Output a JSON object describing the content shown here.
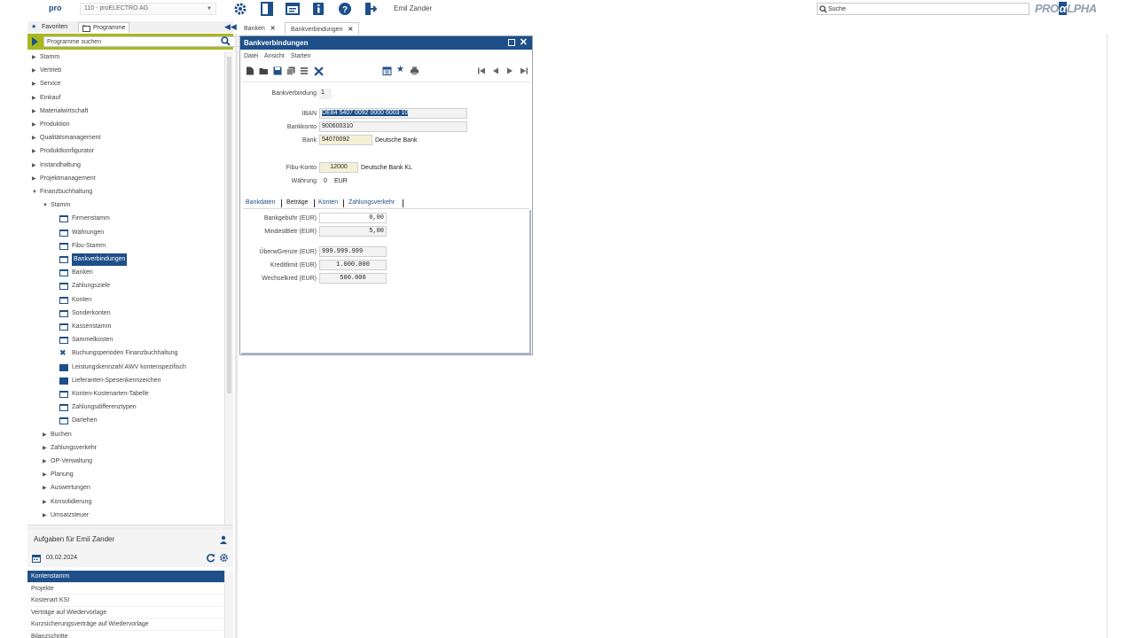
{
  "topbar": {
    "logo": "pro",
    "company": "110 - proELECTRO AG",
    "icons": [
      "gear-icon",
      "layout-icon",
      "panel-icon",
      "info-icon",
      "help-icon",
      "exit-icon"
    ],
    "user": "Emil Zander",
    "search_value": "Suche",
    "brand_pre": "PRO",
    "brand_box": "α",
    "brand_post": "LPHA"
  },
  "left_tabs": {
    "favorites": "Favoriten",
    "programs": "Programme"
  },
  "program_search": {
    "placeholder": "Programme suchen"
  },
  "tree": [
    {
      "label": "Stamm",
      "level": 0,
      "type": "folder",
      "expanded": false
    },
    {
      "label": "Vertrieb",
      "level": 0,
      "type": "folder",
      "expanded": false
    },
    {
      "label": "Service",
      "level": 0,
      "type": "folder",
      "expanded": false
    },
    {
      "label": "Einkauf",
      "level": 0,
      "type": "folder",
      "expanded": false
    },
    {
      "label": "Materialwirtschaft",
      "level": 0,
      "type": "folder",
      "expanded": false
    },
    {
      "label": "Produktion",
      "level": 0,
      "type": "folder",
      "expanded": false
    },
    {
      "label": "Qualitätsmanagement",
      "level": 0,
      "type": "folder",
      "expanded": false
    },
    {
      "label": "Produktkonfigurator",
      "level": 0,
      "type": "folder",
      "expanded": false
    },
    {
      "label": "Instandhaltung",
      "level": 0,
      "type": "folder",
      "expanded": false
    },
    {
      "label": "Projektmanagement",
      "level": 0,
      "type": "folder",
      "expanded": false
    },
    {
      "label": "Finanzbuchhaltung",
      "level": 0,
      "type": "folder",
      "expanded": true
    },
    {
      "label": "Stamm",
      "level": 1,
      "type": "folder",
      "expanded": true
    },
    {
      "label": "Firmenstamm",
      "level": 2,
      "type": "window"
    },
    {
      "label": "Währungen",
      "level": 2,
      "type": "window"
    },
    {
      "label": "Fibu-Stamm",
      "level": 2,
      "type": "window"
    },
    {
      "label": "Bankverbindungen",
      "level": 2,
      "type": "window",
      "selected": true
    },
    {
      "label": "Banken",
      "level": 2,
      "type": "window"
    },
    {
      "label": "Zahlungsziele",
      "level": 2,
      "type": "window"
    },
    {
      "label": "Konten",
      "level": 2,
      "type": "window"
    },
    {
      "label": "Sonderkonten",
      "level": 2,
      "type": "window"
    },
    {
      "label": "Kassenstamm",
      "level": 2,
      "type": "window"
    },
    {
      "label": "Sammelkosten",
      "level": 2,
      "type": "window"
    },
    {
      "label": "Buchungsperioden Finanzbuchhaltung",
      "level": 2,
      "type": "tool"
    },
    {
      "label": "Leistungskennzahl AWV kontenspezifisch",
      "level": 2,
      "type": "stack"
    },
    {
      "label": "Lieferanten-Spesenkennzeichen",
      "level": 2,
      "type": "stack"
    },
    {
      "label": "Konten-Kostenarten-Tabelle",
      "level": 2,
      "type": "window"
    },
    {
      "label": "Zahlungsdifferenztypen",
      "level": 2,
      "type": "window"
    },
    {
      "label": "Darlehen",
      "level": 2,
      "type": "window"
    },
    {
      "label": "Buchen",
      "level": 1,
      "type": "folder",
      "expanded": false
    },
    {
      "label": "Zahlungsverkehr",
      "level": 1,
      "type": "folder",
      "expanded": false
    },
    {
      "label": "OP-Verwaltung",
      "level": 1,
      "type": "folder",
      "expanded": false
    },
    {
      "label": "Planung",
      "level": 1,
      "type": "folder",
      "expanded": false
    },
    {
      "label": "Auswertungen",
      "level": 1,
      "type": "folder",
      "expanded": false
    },
    {
      "label": "Konsolidierung",
      "level": 1,
      "type": "folder",
      "expanded": false
    },
    {
      "label": "Umsatzsteuer",
      "level": 1,
      "type": "folder",
      "expanded": false
    }
  ],
  "tasks": {
    "title": "Aufgaben für Emil Zander",
    "date": "03.02.2024",
    "items": [
      {
        "label": "Kontenstamm",
        "selected": true
      },
      {
        "label": "Projekte"
      },
      {
        "label": "Kostenart KSI"
      },
      {
        "label": "Verträge auf Wiedervorlage"
      },
      {
        "label": "Kurzsicherungsverträge auf Wiedervorlage"
      },
      {
        "label": "Bilanzschritte"
      }
    ]
  },
  "doc_tabs": {
    "tab1": "Banken",
    "tab2": "Bankverbindungen"
  },
  "window": {
    "title": "Bankverbindungen",
    "menu": [
      "Datei",
      "Ansicht",
      "Starten"
    ],
    "fields": {
      "bankverbindung_label": "Bankverbindung",
      "bankverbindung_value": "1",
      "iban_label": "IBAN",
      "iban_value": "DE84 5407 0092 0000 6003 10",
      "bankkonto_label": "Bankkonto",
      "bankkonto_value": "900600310",
      "bank_label": "Bank",
      "bank_value": "54070092",
      "bank_name": "Deutsche Bank",
      "fibu_label": "Fibu-Konto",
      "fibu_value": "12000",
      "fibu_name": "Deutsche Bank KL",
      "waehrung_label": "Währung",
      "waehrung_value": "0",
      "waehrung_code": "EUR"
    },
    "subtabs": [
      "Bankdaten",
      "Beträge",
      "Konten",
      "Zahlungsverkehr"
    ],
    "active_subtab": "Beträge",
    "amounts": {
      "bankgebuehr_label": "Bankgebühr (EUR)",
      "bankgebuehr_value": "0,00",
      "mindestbetrag_label": "MindestBetr (EUR)",
      "mindestbetrag_value": "5,00",
      "obergrenze_label": "ÜberwGrenze (EUR)",
      "obergrenze_value": "999.999.999",
      "kreditlimit_label": "Kreditlimit (EUR)",
      "kreditlimit_value": "1.000.000",
      "wechselkredit_label": "Wechselkred (EUR)",
      "wechselkredit_value": "500.000"
    }
  },
  "colors": {
    "accent": "#1e4f89",
    "search_bar": "#a8b820"
  }
}
